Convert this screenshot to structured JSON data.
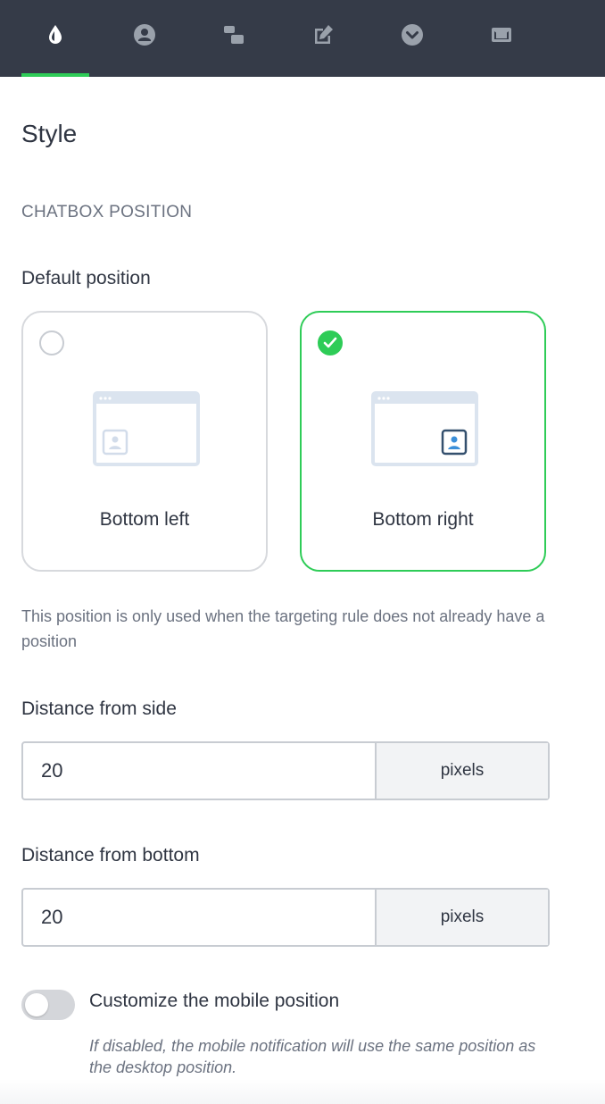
{
  "nav": {
    "tabs": [
      {
        "icon": "droplet-icon",
        "active": true
      },
      {
        "icon": "user-circle-icon",
        "active": false
      },
      {
        "icon": "chat-bubbles-icon",
        "active": false
      },
      {
        "icon": "edit-icon",
        "active": false
      },
      {
        "icon": "chevron-circle-icon",
        "active": false
      },
      {
        "icon": "mail-icon",
        "active": false
      }
    ],
    "active_color": "#2ecc57",
    "bar_color": "#353b48"
  },
  "page": {
    "title": "Style",
    "section": "CHATBOX POSITION"
  },
  "position": {
    "label": "Default position",
    "options": [
      {
        "label": "Bottom left",
        "selected": false
      },
      {
        "label": "Bottom right",
        "selected": true
      }
    ],
    "help": "This position is only used when the targeting rule does not already have a position"
  },
  "side": {
    "label": "Distance from side",
    "value": "20",
    "unit": "pixels"
  },
  "bottom": {
    "label": "Distance from bottom",
    "value": "20",
    "unit": "pixels"
  },
  "mobile": {
    "label": "Customize the mobile position",
    "enabled": false,
    "note": "If disabled, the mobile notification will use the same position as the desktop position."
  }
}
